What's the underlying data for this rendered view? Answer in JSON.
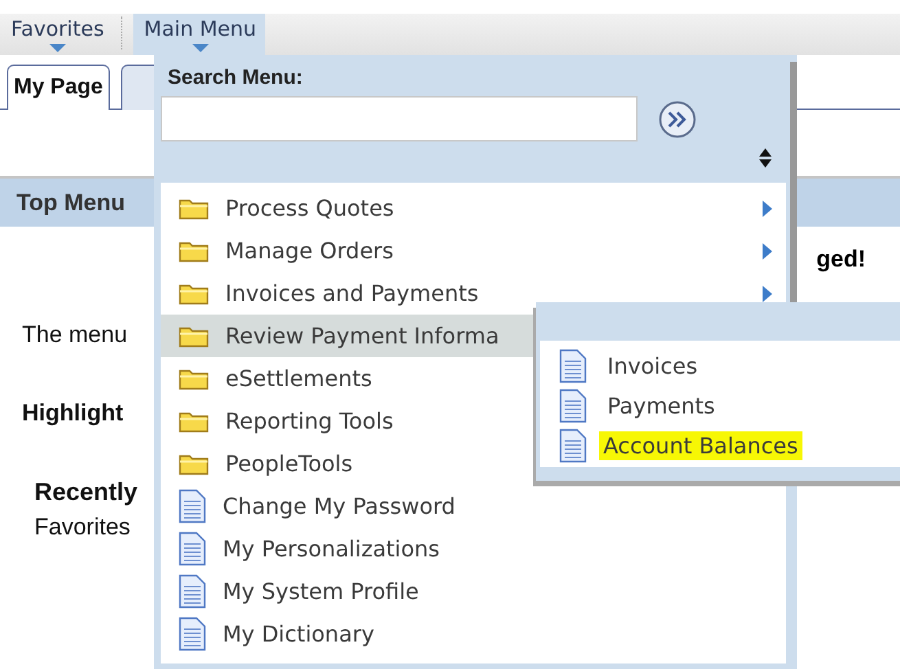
{
  "menubar": {
    "items": [
      {
        "label": "Favorites",
        "selected": false
      },
      {
        "label": "Main Menu",
        "selected": true
      }
    ]
  },
  "tabs": [
    {
      "label": "My Page",
      "selected": true
    }
  ],
  "page": {
    "section_header": "Top Menu",
    "notice": "ged!",
    "blocks": [
      {
        "text": "The menu",
        "kind": "text"
      },
      {
        "text": "Highlight",
        "kind": "heading"
      },
      {
        "text": "Recently",
        "kind": "subheading"
      },
      {
        "text": "Favorites",
        "kind": "subtext"
      }
    ]
  },
  "main_menu": {
    "search_label": "Search Menu:",
    "items": [
      {
        "label": "Process Quotes",
        "kind": "folder",
        "has_submenu": true,
        "selected": false
      },
      {
        "label": "Manage Orders",
        "kind": "folder",
        "has_submenu": true,
        "selected": false
      },
      {
        "label": "Invoices and Payments",
        "kind": "folder",
        "has_submenu": true,
        "selected": false
      },
      {
        "label": "Review Payment Informa",
        "kind": "folder",
        "has_submenu": false,
        "selected": true
      },
      {
        "label": "eSettlements",
        "kind": "folder",
        "has_submenu": false,
        "selected": false
      },
      {
        "label": "Reporting Tools",
        "kind": "folder",
        "has_submenu": false,
        "selected": false
      },
      {
        "label": "PeopleTools",
        "kind": "folder",
        "has_submenu": false,
        "selected": false
      },
      {
        "label": "Change My Password",
        "kind": "page",
        "has_submenu": false,
        "selected": false
      },
      {
        "label": "My Personalizations",
        "kind": "page",
        "has_submenu": false,
        "selected": false
      },
      {
        "label": "My System Profile",
        "kind": "page",
        "has_submenu": false,
        "selected": false
      },
      {
        "label": "My Dictionary",
        "kind": "page",
        "has_submenu": false,
        "selected": false
      }
    ]
  },
  "submenu": {
    "items": [
      {
        "label": "Invoices",
        "kind": "page",
        "highlighted": false
      },
      {
        "label": "Payments",
        "kind": "page",
        "highlighted": false
      },
      {
        "label": "Account Balances",
        "kind": "page",
        "highlighted": true
      }
    ]
  }
}
